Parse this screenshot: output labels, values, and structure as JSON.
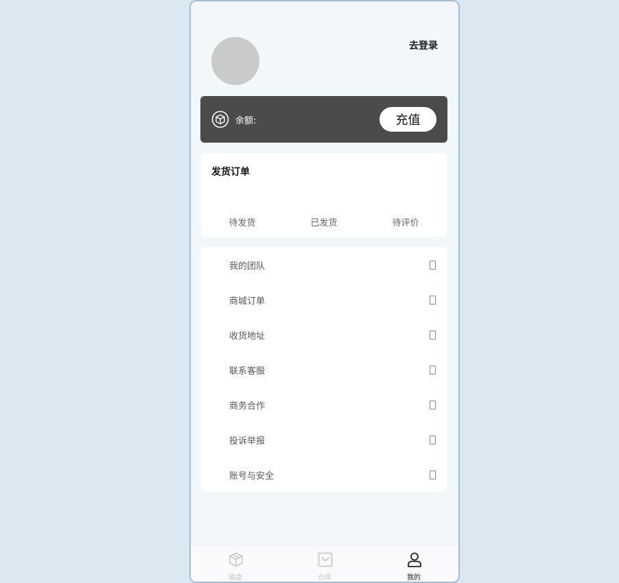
{
  "profile": {
    "login_label": "去登录"
  },
  "balance": {
    "label": "余额:",
    "recharge_label": "充值"
  },
  "orders": {
    "title": "发货订单",
    "tabs": [
      "待发货",
      "已发货",
      "待评价"
    ]
  },
  "menu": {
    "items": [
      "我的团队",
      "商城订单",
      "收货地址",
      "联系客服",
      "商务合作",
      "投诉举报",
      "账号与安全"
    ]
  },
  "tabbar": {
    "items": [
      {
        "label": "抽盒",
        "icon": "box-icon",
        "active": false
      },
      {
        "label": "仓库",
        "icon": "inbox-icon",
        "active": false
      },
      {
        "label": "我的",
        "icon": "user-icon",
        "active": true
      }
    ],
    "active_color": "#222222",
    "inactive_color": "#c8c8c8"
  },
  "colors": {
    "balance_card": "#4b4b4b",
    "page_background": "#f2f7fa",
    "outer_background": "#dce8f1"
  }
}
